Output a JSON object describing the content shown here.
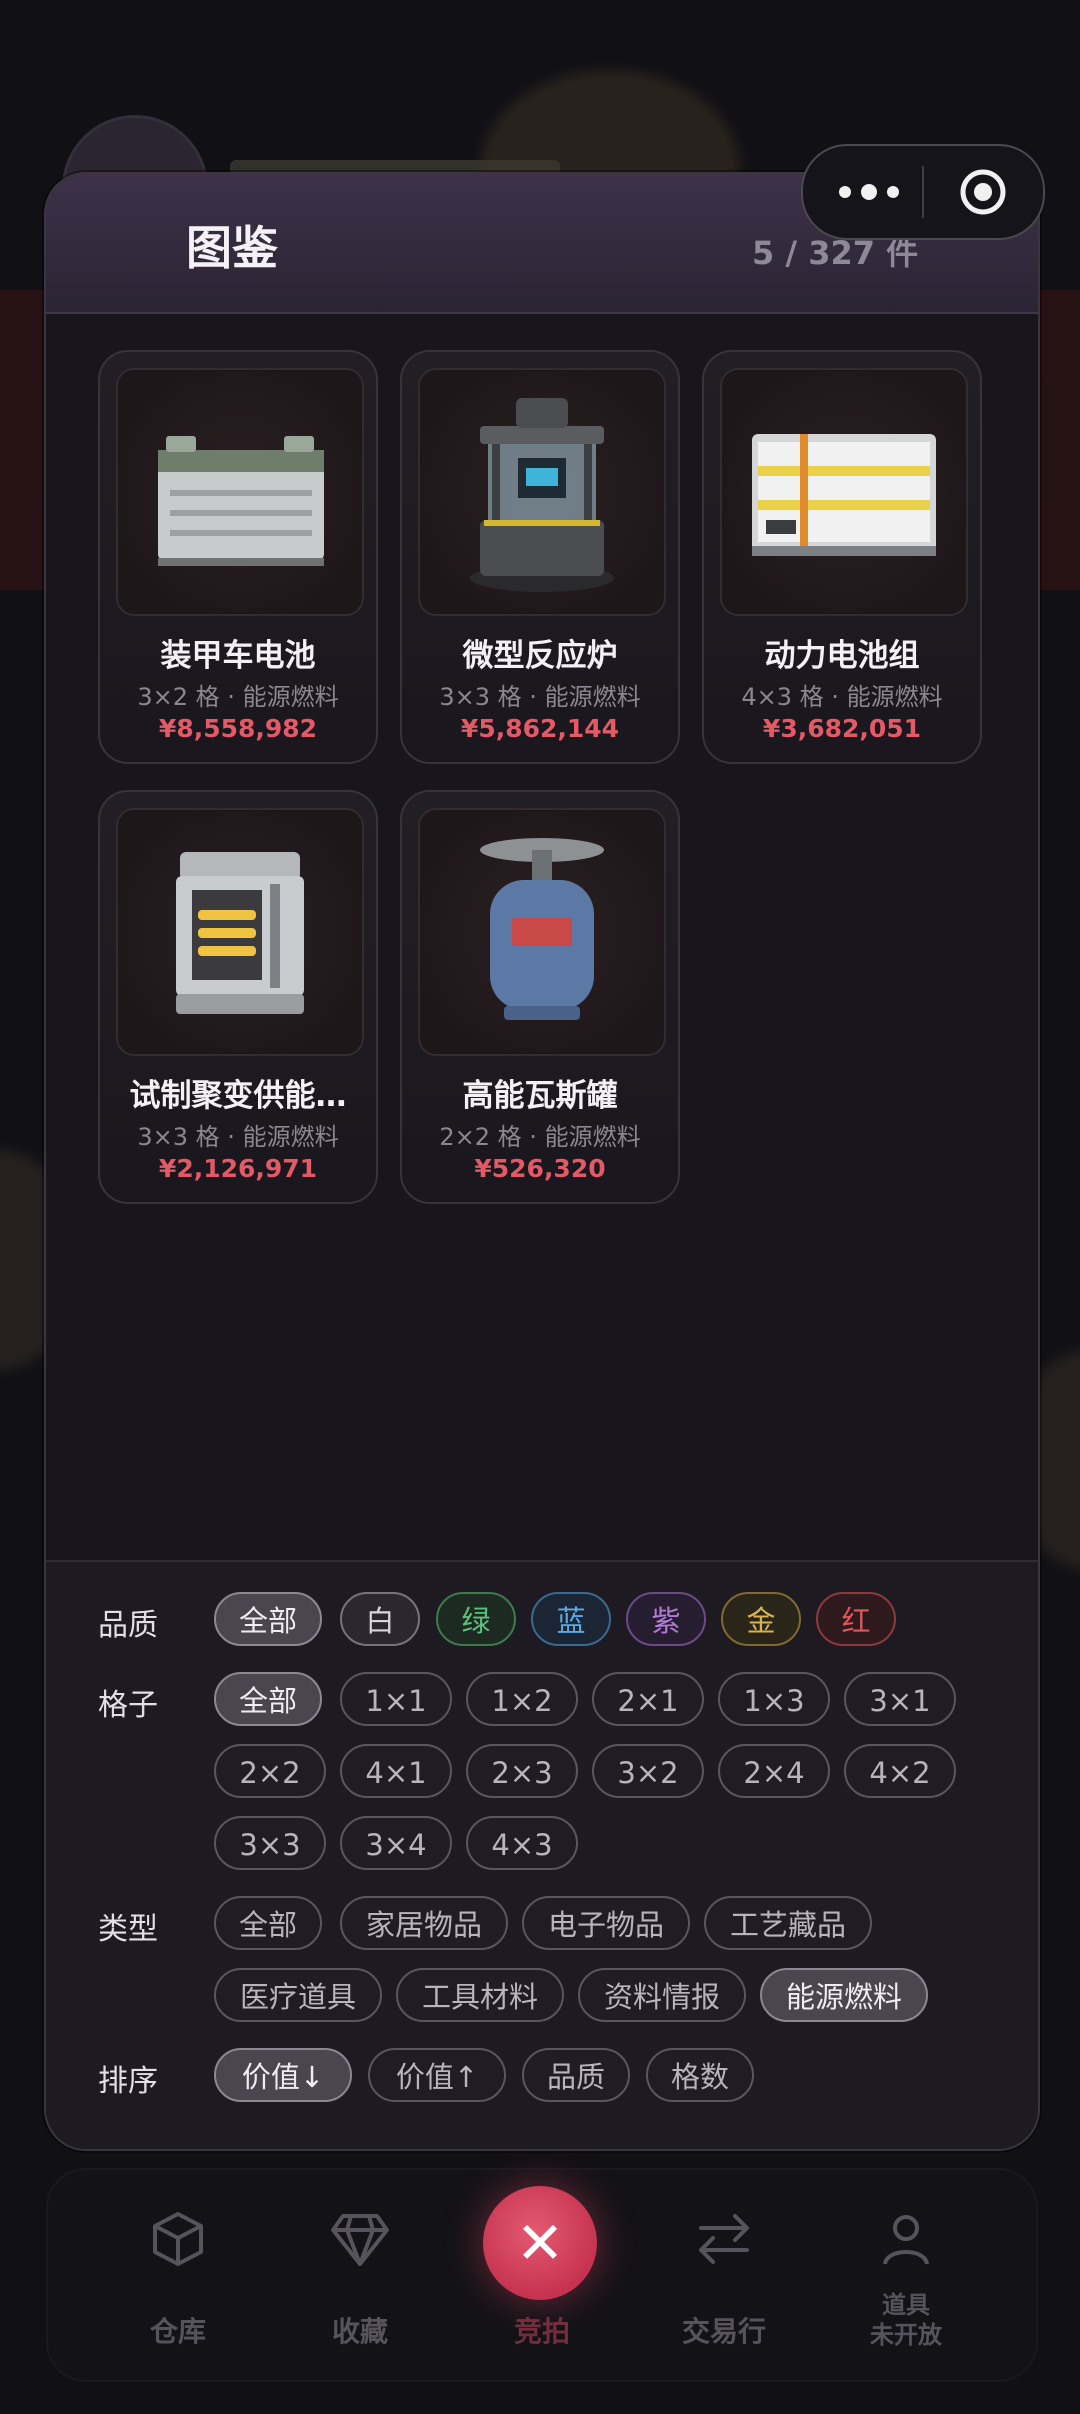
{
  "background_tabbar": {
    "tabs": [
      {
        "label": "仓库",
        "icon": "box-icon"
      },
      {
        "label": "收藏",
        "icon": "diamond-icon"
      },
      {
        "label": "竞拍",
        "icon": "close-icon"
      },
      {
        "label": "交易行",
        "icon": "exchange-icon"
      },
      {
        "label": "道具\n未开放",
        "icon": "person-icon"
      }
    ]
  },
  "capsule": {
    "more_icon": "more-dots-icon",
    "close_icon": "target-icon"
  },
  "modal": {
    "title": "图鉴",
    "count": "5 / 327 件",
    "items": [
      {
        "name": "装甲车电池",
        "meta": "3×2 格 · 能源燃料",
        "price": "¥8,558,982",
        "icon": "car-battery-icon"
      },
      {
        "name": "微型反应炉",
        "meta": "3×3 格 · 能源燃料",
        "price": "¥5,862,144",
        "icon": "reactor-icon"
      },
      {
        "name": "动力电池组",
        "meta": "4×3 格 · 能源燃料",
        "price": "¥3,682,051",
        "icon": "battery-pack-icon"
      },
      {
        "name": "试制聚变供能…",
        "meta": "3×3 格 · 能源燃料",
        "price": "¥2,126,971",
        "icon": "fusion-cell-icon"
      },
      {
        "name": "高能瓦斯罐",
        "meta": "2×2 格 · 能源燃料",
        "price": "¥526,320",
        "icon": "gas-canister-icon"
      }
    ],
    "filters": {
      "quality": {
        "label": "品质",
        "options": [
          {
            "text": "全部",
            "color": "#b8b4bd",
            "active": true
          },
          {
            "text": "白",
            "color": "#d8d6dc"
          },
          {
            "text": "绿",
            "color": "#5fc07c"
          },
          {
            "text": "蓝",
            "color": "#5ea9e2"
          },
          {
            "text": "紫",
            "color": "#b27bd8"
          },
          {
            "text": "金",
            "color": "#d8b352"
          },
          {
            "text": "红",
            "color": "#e0555c"
          }
        ]
      },
      "grid": {
        "label": "格子",
        "options": [
          "全部",
          "1×1",
          "1×2",
          "2×1",
          "1×3",
          "3×1",
          "2×2",
          "4×1",
          "2×3",
          "3×2",
          "2×4",
          "4×2",
          "3×3",
          "3×4",
          "4×3"
        ]
      },
      "type": {
        "label": "类型",
        "options": [
          "全部",
          "家居物品",
          "电子物品",
          "工艺藏品",
          "医疗道具",
          "工具材料",
          "资料情报",
          "能源燃料"
        ]
      },
      "sort": {
        "label": "排序",
        "options": [
          "价值↓",
          "价值↑",
          "品质",
          "格数"
        ]
      }
    }
  }
}
